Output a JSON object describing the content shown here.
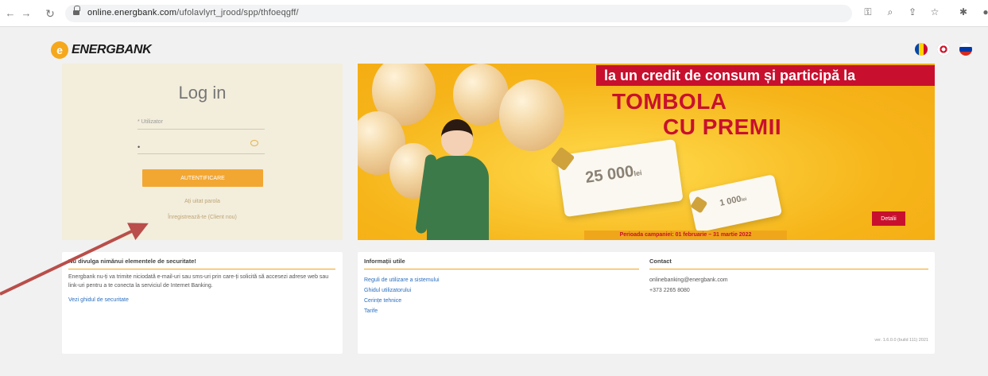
{
  "browser": {
    "url_host": "online.energbank.com",
    "url_path": "/ufolavlyrt_jrood/spp/thfoeqgff/"
  },
  "brand": {
    "logo_text": "ENERGBANK",
    "logo_letter": "e",
    "accent_color": "#f2a733",
    "banner_red": "#c8102e"
  },
  "languages": [
    {
      "code": "ro",
      "icon": "moldova-flag-icon"
    },
    {
      "code": "en",
      "icon": "uk-flag-icon"
    },
    {
      "code": "ru",
      "icon": "russia-flag-icon"
    }
  ],
  "login": {
    "title": "Log in",
    "username_label": "* Utilizator",
    "password_value": "•",
    "submit_label": "AUTENTIFICARE",
    "forgot_link": "Ați uitat parola",
    "register_link": "Înregistrează-te (Client nou)"
  },
  "banner": {
    "top_text": "la un credit de consum și participă la",
    "headline_1": "TOMBOLA",
    "headline_2": "CU PREMII",
    "amount_big": "25 000",
    "amount_big_unit": "lei",
    "amount_small": "1 000",
    "amount_small_unit": "lei",
    "period": "Perioada campaniei: 01 februarie – 31 martie 2022",
    "details_label": "Detalii"
  },
  "security": {
    "title": "Nu divulga nimănui elementele de securitate!",
    "text": "Energbank nu-ți va trimite niciodată e-mail-uri sau sms-uri prin care-ți solicită să accesezi adrese web sau link-uri pentru a te conecta la serviciul de Internet Banking.",
    "link": "Vezi ghidul de securitate"
  },
  "info": {
    "title": "Informații utile",
    "links": [
      "Reguli de utilizare a sistemului",
      "Ghidul utilizatorului",
      "Cerințe tehnice",
      "Tarife"
    ]
  },
  "contact": {
    "title": "Contact",
    "email": "onlinebanking@energbank.com",
    "phone": "+373 2265 8080"
  },
  "version": "ver. 1.6.0.0 (build 111) 2021"
}
